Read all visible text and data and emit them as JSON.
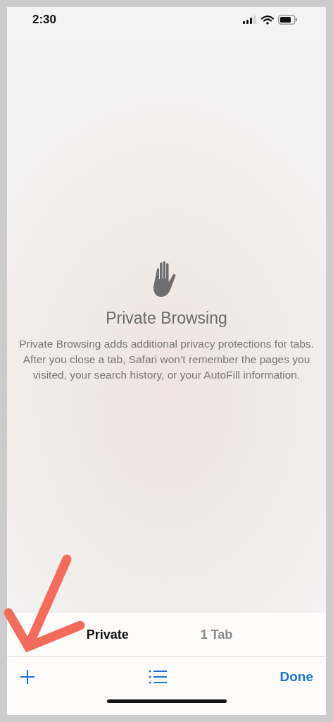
{
  "status_bar": {
    "time": "2:30"
  },
  "empty_state": {
    "title": "Private Browsing",
    "description": "Private Browsing adds additional privacy protections for tabs. After you close a tab, Safari won’t remember the pages you visited, your search history, or your AutoFill information."
  },
  "tab_groups": [
    {
      "label": "Private",
      "selected": true
    },
    {
      "label": "1 Tab",
      "selected": false
    }
  ],
  "toolbar": {
    "done": "Done"
  },
  "annotation": {
    "kind": "arrow"
  }
}
